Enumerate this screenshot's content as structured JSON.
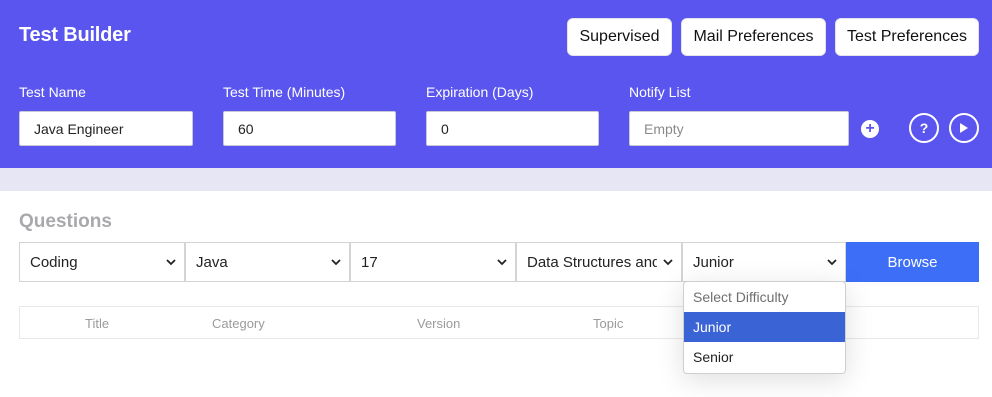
{
  "header": {
    "title": "Test Builder",
    "buttons": {
      "supervised": "Supervised",
      "mail_preferences": "Mail Preferences",
      "test_preferences": "Test Preferences"
    },
    "fields": {
      "test_name": {
        "label": "Test Name",
        "value": "Java Engineer"
      },
      "test_time": {
        "label": "Test Time (Minutes)",
        "value": "60"
      },
      "expiration": {
        "label": "Expiration (Days)",
        "value": "0"
      },
      "notify_list": {
        "label": "Notify List",
        "placeholder": "Empty"
      }
    },
    "icons": {
      "add": "plus-icon",
      "help": "question-icon",
      "play": "play-icon"
    },
    "help_glyph": "?",
    "add_glyph": "+"
  },
  "questions": {
    "title": "Questions",
    "filters": {
      "type": "Coding",
      "language": "Java",
      "version": "17",
      "topic": "Data Structures and",
      "difficulty": "Junior"
    },
    "browse_label": "Browse",
    "columns": [
      "Title",
      "Category",
      "Version",
      "Topic"
    ],
    "difficulty_options": [
      {
        "label": "Select Difficulty",
        "state": "disabled"
      },
      {
        "label": "Junior",
        "state": "selected"
      },
      {
        "label": "Senior",
        "state": "normal"
      }
    ]
  },
  "colors": {
    "header_bg": "#5a55ee",
    "browse_bg": "#3d6ef7",
    "option_highlight": "#3a63d5"
  }
}
